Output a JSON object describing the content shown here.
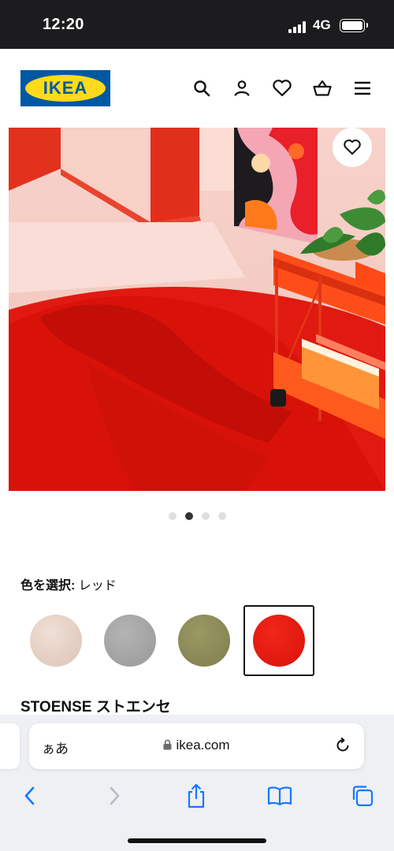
{
  "status_bar": {
    "time": "12:20",
    "network": "4G"
  },
  "header": {
    "logo_text": "IKEA",
    "icons": [
      "search-icon",
      "account-icon",
      "heart-icon",
      "basket-icon",
      "menu-icon"
    ]
  },
  "hero": {
    "favorite_icon": "heart-icon"
  },
  "carousel": {
    "count": 4,
    "active": 1
  },
  "color_select": {
    "label": "色を選択:",
    "value": "レッド",
    "swatches": [
      {
        "color": "#e6cfc3",
        "selected": false
      },
      {
        "color": "#a3a3a3",
        "selected": false
      },
      {
        "color": "#8c8b58",
        "selected": false
      },
      {
        "color": "#e81a0d",
        "selected": true
      }
    ]
  },
  "product": {
    "title": "STOENSE ストエンセ"
  },
  "browser": {
    "aa_label": "ぁあ",
    "url": "ikea.com",
    "toolbar": [
      "back-icon",
      "forward-icon",
      "share-icon",
      "bookmarks-icon",
      "tabs-icon"
    ]
  },
  "colors": {
    "ikea_blue": "#0058a3",
    "ikea_yellow": "#ffda1a",
    "rug_red": "#e81a0d"
  }
}
